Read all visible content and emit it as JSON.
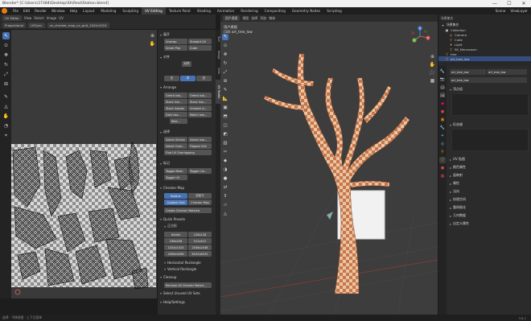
{
  "window": {
    "title": "Blender* [C:\\Users\\37384\\Desktop\\Sh\\Real\\Station.blend]",
    "controls": [
      "—",
      "☐",
      "✕"
    ]
  },
  "menu": {
    "items": [
      "File",
      "Edit",
      "Render",
      "Window",
      "Help"
    ],
    "workspaces": [
      "Layout",
      "Modeling",
      "Sculpting",
      "UV Editing",
      "Texture Paint",
      "Shading",
      "Animation",
      "Rendering",
      "Compositing",
      "Geometry Nodes",
      "Scripting"
    ],
    "active_workspace": "UV Editing",
    "scene_label": "Scene",
    "viewlayer_label": "ViewLayer"
  },
  "uv_editor": {
    "header_row1": [
      "UV Editor",
      "View",
      "Select",
      "Image",
      "UV"
    ],
    "header_row2": [
      "Proportional",
      "UVSync",
      "uv_checker_map_uv_grid_1024x1024"
    ],
    "tools": [
      "cursor",
      "select",
      "grab",
      "rotate",
      "scale",
      "transform",
      "annotate",
      "rip",
      "grab-brush",
      "relax",
      "pinch"
    ],
    "nav": [
      "⊕",
      "✋"
    ]
  },
  "npanel": {
    "tabs": [
      "Tool",
      "Image",
      "View",
      "UV Toolkit"
    ],
    "active_tab": "UV Toolkit",
    "sec_unwrap": "展开",
    "btns_unwrap": [
      "Unwrap",
      "Straight UV",
      "Smart Proj",
      "Cube"
    ],
    "sec_align": "对齐",
    "btns_align": [
      "对齐",
      "左",
      "中",
      "右"
    ],
    "sec_arrange": "Arrange",
    "btns_arrange": [
      "Orient isla...",
      "Orient isla...",
      "Stack Isla...",
      "Stack Isla...",
      "Stack Islands",
      "Unstack Is...",
      "Distr Isla...",
      "Match Isla...",
      "Rela..."
    ],
    "sec_select": "选择",
    "btns_select": [
      "Select Similar",
      "Select Isla...",
      "Select Over...",
      "Flipped UVs",
      "Find UV Overlapping"
    ],
    "sec_mark": "标记",
    "btns_mark": [
      "Toggle Mesh",
      "Toggle Col...",
      "Toggle UV"
    ],
    "sec_checker": "Checker Map",
    "btns_checker": [
      "Built-In",
      "自定义",
      "Custom Grid",
      "Checker Map"
    ],
    "create_checker": "Create Checker Material",
    "sec_quick": "Quick Presets",
    "subsec_res": "正方形",
    "resolutions": [
      "64x64",
      "128x128",
      "256x256",
      "512x512",
      "1024x1024",
      "2048x2048",
      "4096x4096",
      "8192x8192"
    ],
    "horizontal": "Horizontal Rectangle",
    "vertical": "Vertical Rectangle",
    "sec_cleanup": "Cleanup",
    "remove_checker": "Remove All Checker Materi...",
    "select_unused": "Select Unused UV Sets",
    "help": "Help/Settings"
  },
  "viewport": {
    "header": [
      "用户透视",
      "视图",
      "选择",
      "添加",
      "物体"
    ],
    "overlay_title": "用户透视",
    "overlay_object": "(18) art_tree_low",
    "gizmo_axes": [
      "X",
      "Y",
      "Z"
    ],
    "nav": [
      "⊕",
      "✋",
      "🎥",
      "▦"
    ]
  },
  "outliner": {
    "header": "场景集合",
    "rows": [
      {
        "icon": "▾",
        "label": "场景集合",
        "indent": 0
      },
      {
        "icon": "▣",
        "label": "Collection",
        "indent": 1
      },
      {
        "icon": "◎",
        "label": "Camera",
        "indent": 2
      },
      {
        "icon": "▽",
        "label": "Cube",
        "indent": 2
      },
      {
        "icon": "☀",
        "label": "Light",
        "indent": 2
      },
      {
        "icon": "▽",
        "label": "SK_Mannequin",
        "indent": 2
      },
      {
        "icon": "▽",
        "label": "tree",
        "indent": 1
      },
      {
        "icon": "▽",
        "label": "art_tree_low",
        "indent": 1,
        "selected": true
      }
    ]
  },
  "properties": {
    "object_name": "art_tree_low",
    "data_name": "art_tree_low",
    "sections": [
      "顶点组",
      "形态键",
      "UV 贴图",
      "颜色属性",
      "面映射",
      "属性",
      "法向",
      "纹理空间",
      "重网格化",
      "几何数据",
      "自定义属性"
    ],
    "open": [
      true,
      true,
      false,
      false,
      false,
      false,
      false,
      false,
      false,
      false,
      false
    ]
  },
  "status": {
    "left": "选择  ·  平移视图  ·  上下文菜单",
    "version": "3.6.1"
  }
}
